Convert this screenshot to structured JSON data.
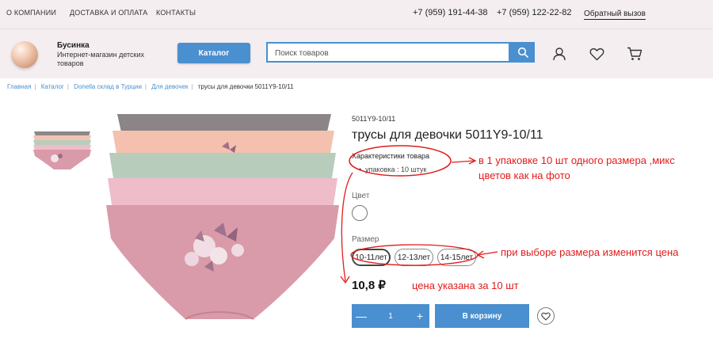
{
  "topbar": {
    "links": [
      "О КОМПАНИИ",
      "ДОСТАВКА И ОПЛАТА",
      "КОНТАКТЫ"
    ],
    "phones": [
      "+7 (959) 191-44-38",
      "+7 (959) 122-22-82"
    ],
    "callback": "Обратный вызов"
  },
  "header": {
    "brand": "Бусинка",
    "tagline": "Интернет-магазин детских товаров",
    "catalog_label": "Каталог",
    "search_placeholder": "Поиск товаров",
    "icons": [
      "search-icon",
      "user-icon",
      "heart-icon",
      "cart-icon"
    ]
  },
  "breadcrumb": {
    "items": [
      "Главная",
      "Каталог",
      "Donella склад в Турции",
      "Для девочек"
    ],
    "current": "трусы для девочки 5011Y9-10/11"
  },
  "product": {
    "sku": "5011Y9-10/11",
    "title": "трусы для девочки 5011Y9-10/11",
    "characteristics_title": "Характеристики товара",
    "characteristics": [
      "упаковка : 10 штук"
    ],
    "color_label": "Цвет",
    "size_label": "Размер",
    "sizes": [
      "10-11лет",
      "12-13лет",
      "14-15лет"
    ],
    "selected_size": "10-11лет",
    "price": "10,8 ₽",
    "quantity": "1",
    "add_to_cart": "В корзину"
  },
  "annotations": {
    "pack_note_line1": "в 1 упаковке 10 шт одного размера ,микс",
    "pack_note_line2": "цветов как на фото",
    "size_note": "при выборе размера изменится цена",
    "price_note": "цена указана за 10 шт"
  },
  "colors": {
    "accent": "#4a8fcf",
    "header_bg": "#f4eef0",
    "annotation": "#e21b1b"
  }
}
